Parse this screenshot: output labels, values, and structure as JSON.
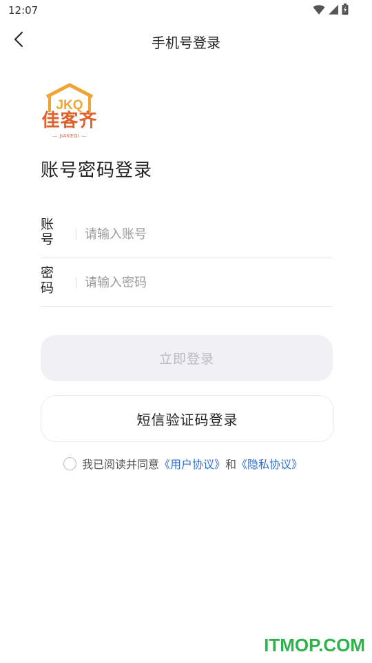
{
  "status_bar": {
    "time": "12:07",
    "icons": [
      "wifi-icon",
      "signal-icon",
      "battery-icon"
    ]
  },
  "nav": {
    "title": "手机号登录",
    "back_icon": "chevron-left-icon"
  },
  "logo": {
    "brand": "佳客齐",
    "mark": "JKQ",
    "sub": "— JIAKEQI —",
    "color": "#e0622a",
    "accent": "#f0a434"
  },
  "heading": "账号密码登录",
  "form": {
    "account": {
      "label": "账号",
      "placeholder": "请输入账号",
      "value": ""
    },
    "password": {
      "label": "密码",
      "placeholder": "请输入密码",
      "value": ""
    }
  },
  "buttons": {
    "login": "立即登录",
    "sms_login": "短信验证码登录"
  },
  "agreement": {
    "checked": false,
    "prefix": "我已阅读并同意",
    "user_agreement": "《用户协议》",
    "conjunction": "和",
    "privacy_policy": "《隐私协议》",
    "link_color": "#2f6fd3"
  },
  "watermark": "ITMOP.COM",
  "colors": {
    "primary_text": "#222222",
    "placeholder": "#9a9a9a",
    "disabled_button_bg": "#f0f0f5",
    "disabled_button_text": "#b9b9c1",
    "watermark": "#2fb24c"
  }
}
